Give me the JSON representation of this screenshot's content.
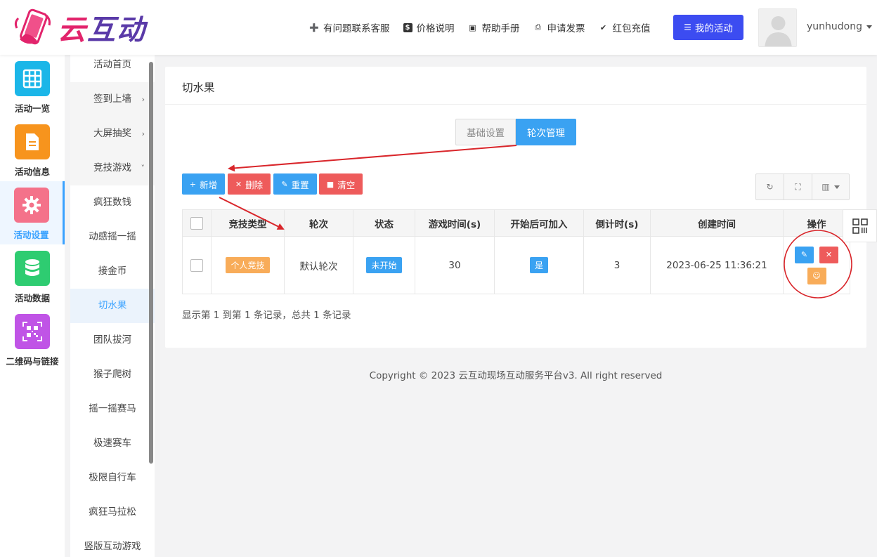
{
  "brand": {
    "logo_text_1": "云",
    "logo_text_2": "互动"
  },
  "nav": {
    "items": [
      {
        "icon": "user-plus-icon",
        "label": "有问题联系客服"
      },
      {
        "icon": "dollar-icon",
        "label": "价格说明"
      },
      {
        "icon": "book-icon",
        "label": "帮助手册"
      },
      {
        "icon": "printer-icon",
        "label": "申请发票"
      },
      {
        "icon": "shield-check-icon",
        "label": "红包充值"
      }
    ],
    "my_activity": "我的活动",
    "username": "yunhudong"
  },
  "iconbar": {
    "items": [
      {
        "label": "活动一览",
        "icon": "grid-icon",
        "color": "#1bb6e8"
      },
      {
        "label": "活动信息",
        "icon": "document-icon",
        "color": "#f7941d"
      },
      {
        "label": "活动设置",
        "icon": "gear-icon",
        "color": "#f4728a"
      },
      {
        "label": "活动数据",
        "icon": "database-icon",
        "color": "#2ecc71"
      },
      {
        "label": "二维码与链接",
        "icon": "qrcode-icon",
        "color": "#c054e6"
      }
    ]
  },
  "submenu": {
    "items": [
      {
        "label": "活动首页",
        "chevron": ""
      },
      {
        "label": "签到上墙",
        "chevron": "›"
      },
      {
        "label": "大屏抽奖",
        "chevron": "›"
      },
      {
        "label": "竞技游戏",
        "chevron": "˅"
      },
      {
        "label": "疯狂数钱",
        "chevron": ""
      },
      {
        "label": "动感摇一摇",
        "chevron": ""
      },
      {
        "label": "接金币",
        "chevron": ""
      },
      {
        "label": "切水果",
        "chevron": ""
      },
      {
        "label": "团队拔河",
        "chevron": ""
      },
      {
        "label": "猴子爬树",
        "chevron": ""
      },
      {
        "label": "摇一摇赛马",
        "chevron": ""
      },
      {
        "label": "极速赛车",
        "chevron": ""
      },
      {
        "label": "极限自行车",
        "chevron": ""
      },
      {
        "label": "疯狂马拉松",
        "chevron": ""
      },
      {
        "label": "竖版互动游戏",
        "chevron": ""
      }
    ]
  },
  "main": {
    "title": "切水果",
    "tabs": {
      "basic": "基础设置",
      "rounds": "轮次管理"
    },
    "buttons": {
      "add": "新增",
      "delete": "删除",
      "reset": "重置",
      "clear": "清空"
    },
    "table": {
      "headers": [
        "竞技类型",
        "轮次",
        "状态",
        "游戏时间(s)",
        "开始后可加入",
        "倒计时(s)",
        "创建时间",
        "操作"
      ],
      "rows": [
        {
          "type": "个人竞技",
          "round": "默认轮次",
          "status": "未开始",
          "game_time": "30",
          "join_after_start": "是",
          "countdown": "3",
          "created": "2023-06-25 11:36:21"
        }
      ]
    },
    "pagination_info": "显示第 1 到第 1 条记录，总共 1 条记录"
  },
  "copyright": "Copyright © 2023 云互动现场互动服务平台v3. All right reserved",
  "colors": {
    "primary": "#3aa2f2",
    "danger": "#ee5b5b",
    "warning": "#f8ac59",
    "accent": "#3c4cf1",
    "annotation": "#d9262b"
  }
}
